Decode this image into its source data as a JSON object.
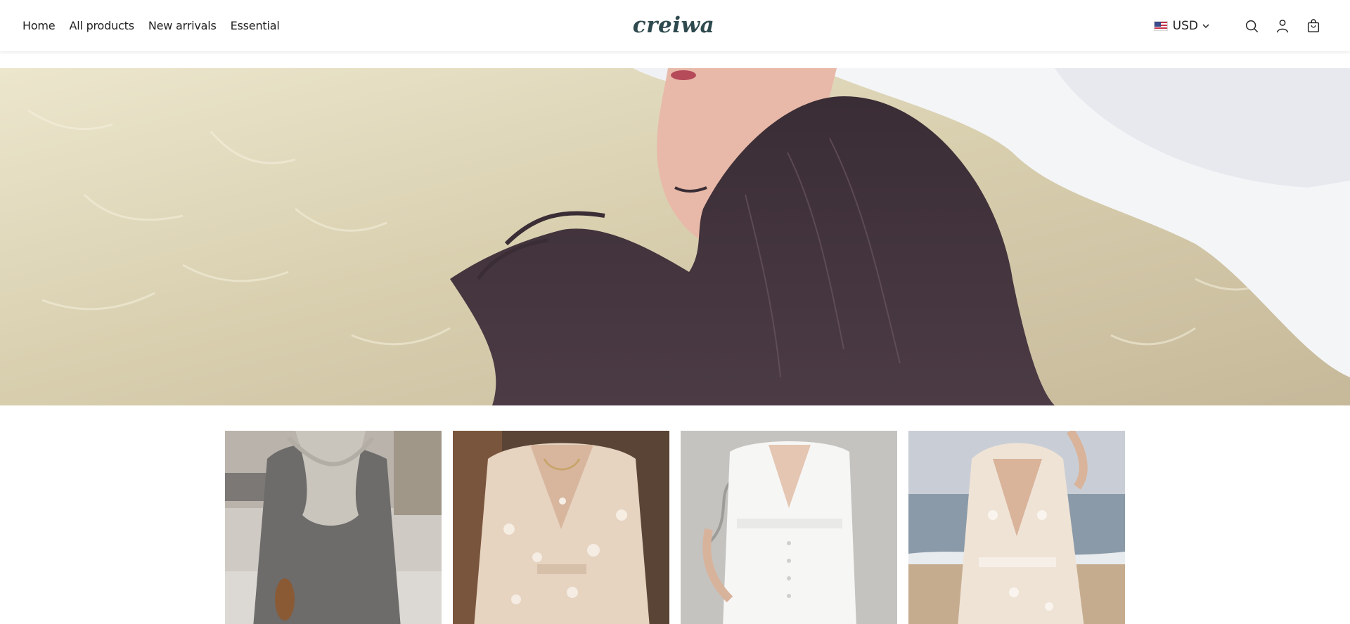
{
  "nav": {
    "items": [
      {
        "label": "Home"
      },
      {
        "label": "All products"
      },
      {
        "label": "New arrivals"
      },
      {
        "label": "Essential"
      }
    ]
  },
  "brand": {
    "logo_text": "creiwa",
    "color": "#2f4a4f"
  },
  "tools": {
    "currency": "USD",
    "icons": [
      "search-icon",
      "account-icon",
      "cart-icon"
    ]
  },
  "hero": {
    "image": "woman-lying-on-fur-rug"
  },
  "products": [
    {
      "image": "grey-sweater-dress-with-scarf"
    },
    {
      "image": "floral-lace-wrap-dress"
    },
    {
      "image": "white-button-midi-dress"
    },
    {
      "image": "lace-v-neck-beach-dress"
    }
  ]
}
